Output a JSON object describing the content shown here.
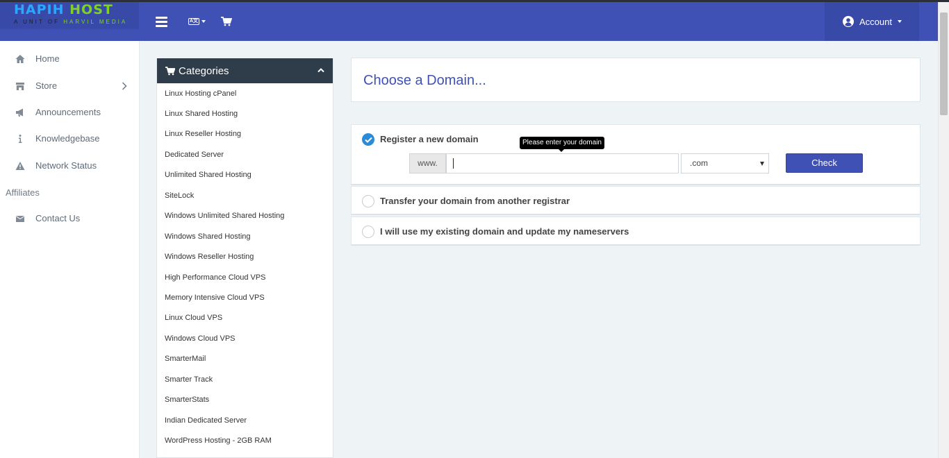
{
  "brand": {
    "name_part1": "HAPIH",
    "name_part2": "HOST",
    "tagline_part1": "A UNIT OF",
    "tagline_part2": "HARVIL MEDIA"
  },
  "topbar": {
    "menu_icon": "hamburger-icon",
    "language_icon": "language-icon",
    "cart_icon": "shopping-cart-icon",
    "account_label": "Account",
    "colors": {
      "bar": "#3f51b5",
      "dark": "#3949a8"
    }
  },
  "sidebar": {
    "items": [
      {
        "label": "Home",
        "icon": "home-icon"
      },
      {
        "label": "Store",
        "icon": "store-icon"
      },
      {
        "label": "Announcements",
        "icon": "megaphone-icon"
      },
      {
        "label": "Knowledgebase",
        "icon": "info-icon"
      },
      {
        "label": "Network Status",
        "icon": "warning-icon"
      }
    ],
    "section": "Affiliates",
    "contact": {
      "label": "Contact Us",
      "icon": "envelope-icon"
    }
  },
  "categories": {
    "title": "Categories",
    "items": [
      "Linux Hosting cPanel",
      "Linux Shared Hosting",
      "Linux Reseller Hosting",
      "Dedicated Server",
      "Unlimited Shared Hosting",
      "SiteLock",
      "Windows Unlimited Shared Hosting",
      "Windows Shared Hosting",
      "Windows Reseller Hosting",
      "High Performance Cloud VPS",
      "Memory Intensive Cloud VPS",
      "Linux Cloud VPS",
      "Windows Cloud VPS",
      "SmarterMail",
      "Smarter Track",
      "SmarterStats",
      "Indian Dedicated Server",
      "WordPress Hosting - 2GB RAM"
    ]
  },
  "main": {
    "title": "Choose a Domain...",
    "options": {
      "register": "Register a new domain",
      "transfer": "Transfer your domain from another registrar",
      "existing": "I will use my existing domain and update my nameservers"
    },
    "www_prefix": "www.",
    "domain_value": "",
    "tld_selected": ".com",
    "check_label": "Check",
    "tooltip": "Please enter your domain"
  }
}
